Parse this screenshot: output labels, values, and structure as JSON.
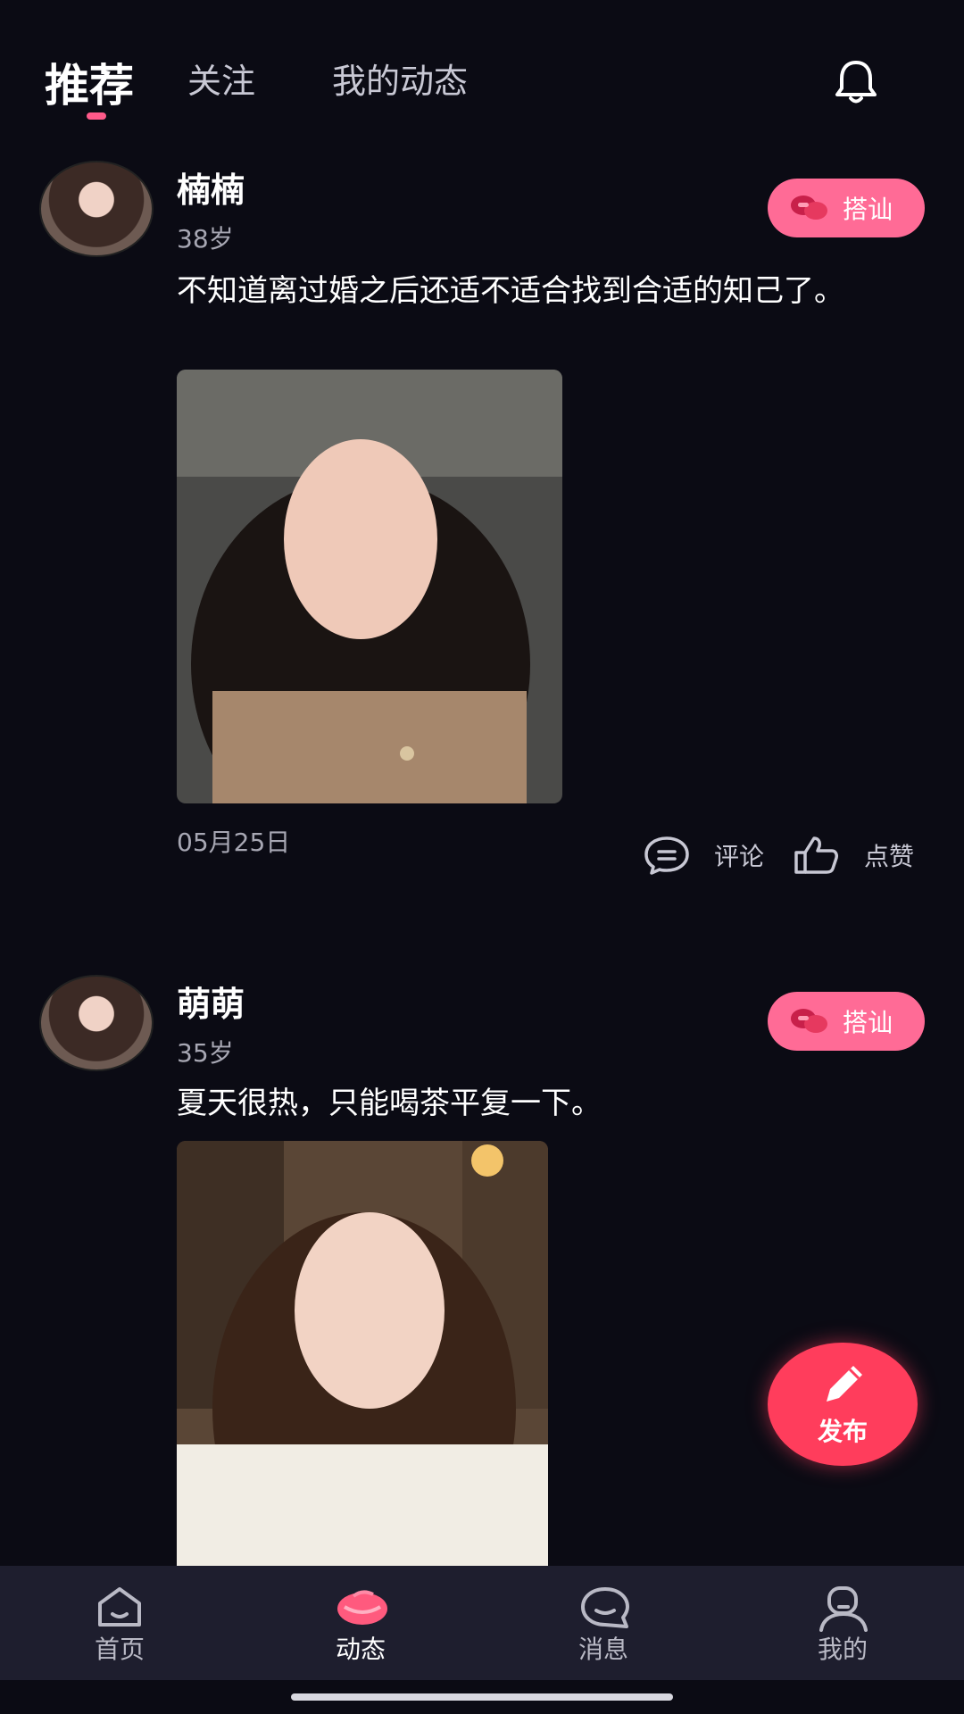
{
  "tabs": [
    {
      "label": "推荐",
      "active": true
    },
    {
      "label": "关注",
      "active": false
    },
    {
      "label": "我的动态",
      "active": false
    }
  ],
  "header": {
    "bell_icon": "bell-icon"
  },
  "posts": [
    {
      "name": "楠楠",
      "age": "38岁",
      "chat_label": "搭讪",
      "text": "不知道离过婚之后还适不适合找到合适的知己了。",
      "date": "05月25日",
      "comment_label": "评论",
      "like_label": "点赞"
    },
    {
      "name": "萌萌",
      "age": "35岁",
      "chat_label": "搭讪",
      "text": "夏天很热，只能喝茶平复一下。"
    }
  ],
  "fab": {
    "label": "发布",
    "icon": "pencil-icon"
  },
  "bottom_nav": [
    {
      "label": "首页",
      "icon": "home-icon",
      "active": false
    },
    {
      "label": "动态",
      "icon": "moments-icon",
      "active": true
    },
    {
      "label": "消息",
      "icon": "message-icon",
      "active": false
    },
    {
      "label": "我的",
      "icon": "profile-icon",
      "active": false
    }
  ],
  "colors": {
    "accent": "#ff6b96",
    "fab": "#ff3d5c",
    "background": "#0b0b14",
    "nav_bg": "#1e1e2e"
  }
}
